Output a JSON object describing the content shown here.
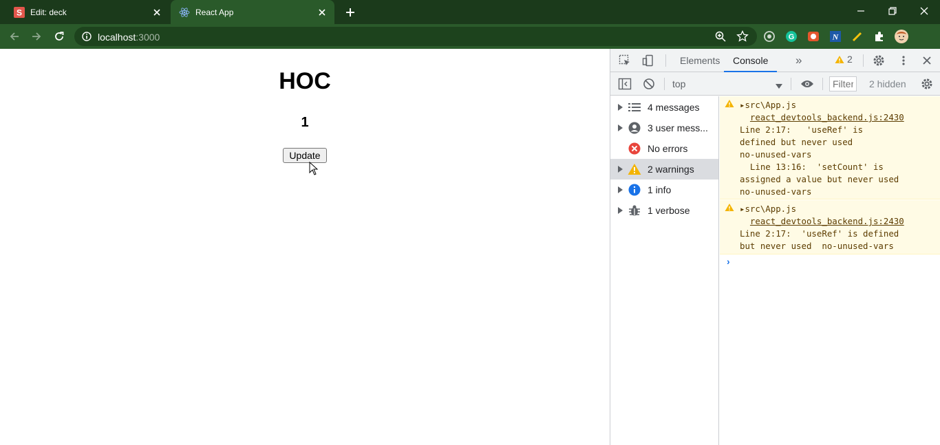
{
  "browser": {
    "tabs": [
      {
        "title": "Edit: deck",
        "favicon": "s-letter-icon",
        "active": false
      },
      {
        "title": "React App",
        "favicon": "react-icon",
        "active": true
      }
    ],
    "address": {
      "host": "localhost",
      "port": ":3000"
    },
    "extensions": [
      "extension-circle-icon",
      "grammarly-icon",
      "extension-red-icon",
      "extension-n-icon",
      "pencil-icon",
      "puzzle-icon",
      "profile-avatar-icon"
    ]
  },
  "page": {
    "heading": "HOC",
    "count": "1",
    "button_label": "Update"
  },
  "devtools": {
    "tabs": {
      "elements": "Elements",
      "console": "Console",
      "more": "»"
    },
    "warning_count": "2",
    "context": "top",
    "filter_placeholder": "Filter",
    "hidden_count": "2 hidden",
    "sidebar": [
      {
        "label": "4 messages",
        "icon": "list-icon",
        "expandable": true
      },
      {
        "label": "3 user mess...",
        "icon": "user-icon",
        "expandable": true
      },
      {
        "label": "No errors",
        "icon": "error-icon",
        "expandable": false
      },
      {
        "label": "2 warnings",
        "icon": "warning-icon",
        "expandable": true,
        "selected": true
      },
      {
        "label": "1 info",
        "icon": "info-icon",
        "expandable": true
      },
      {
        "label": "1 verbose",
        "icon": "bug-icon",
        "expandable": true
      }
    ],
    "messages": [
      {
        "source": "src\\App.js",
        "link": "react_devtools_backend.js:2430",
        "lines": [
          "Line 2:17:   'useRef' is",
          "defined but never used",
          "no-unused-vars",
          "  Line 13:16:  'setCount' is",
          "assigned a value but never used",
          "no-unused-vars"
        ]
      },
      {
        "source": "src\\App.js",
        "link": "react_devtools_backend.js:2430",
        "lines": [
          "Line 2:17:  'useRef' is defined",
          "but never used  no-unused-vars"
        ]
      }
    ],
    "prompt": "›",
    "colors": {
      "warning_bg": "#fffbe5",
      "warning_text": "#5c3c00",
      "accent": "#1a73e8",
      "chrome_green": "#2a5a2a"
    }
  }
}
